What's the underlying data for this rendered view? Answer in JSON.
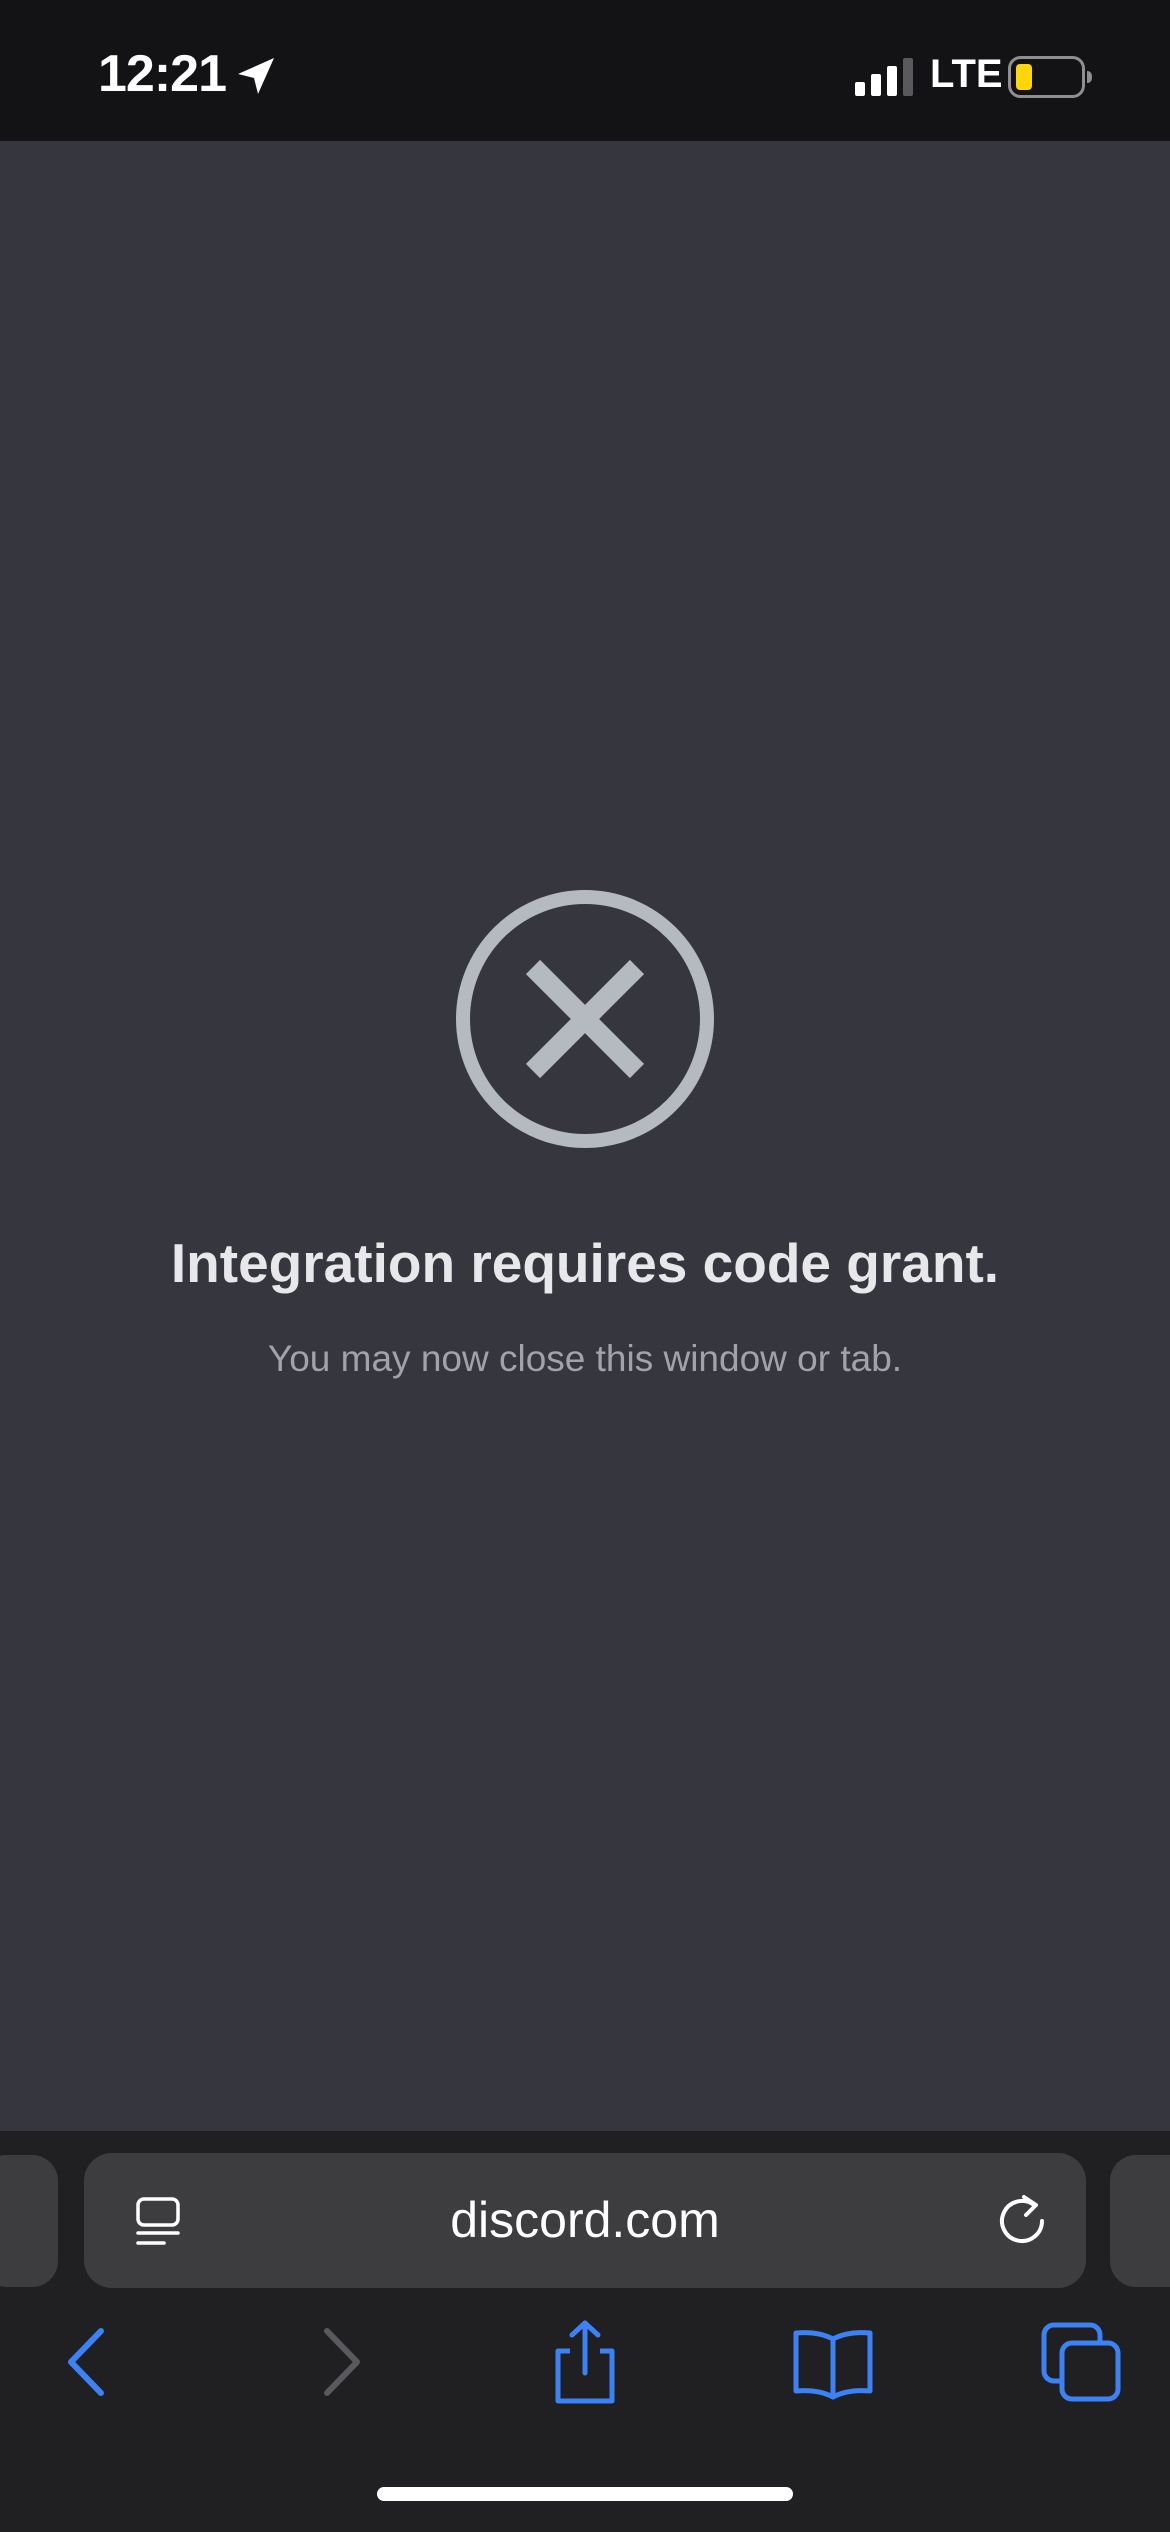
{
  "status_bar": {
    "time": "12:21",
    "network": "LTE",
    "location_icon": "location-arrow-icon",
    "signal_icon": "cellular-signal-icon",
    "battery_icon": "battery-low-icon",
    "battery_color": "#ffd60a"
  },
  "page": {
    "background": "#36363f",
    "icon": "circle-x-icon",
    "icon_color": "#b5b9c0",
    "title": "Integration requires code grant.",
    "subtitle": "You may now close this window or tab."
  },
  "browser": {
    "address": "discord.com",
    "reader_icon": "page-menu-icon",
    "reload_icon": "reload-icon",
    "accent_color": "#3b82f6",
    "toolbar": [
      "back-icon",
      "forward-icon",
      "share-icon",
      "bookmarks-icon",
      "tabs-icon"
    ]
  }
}
